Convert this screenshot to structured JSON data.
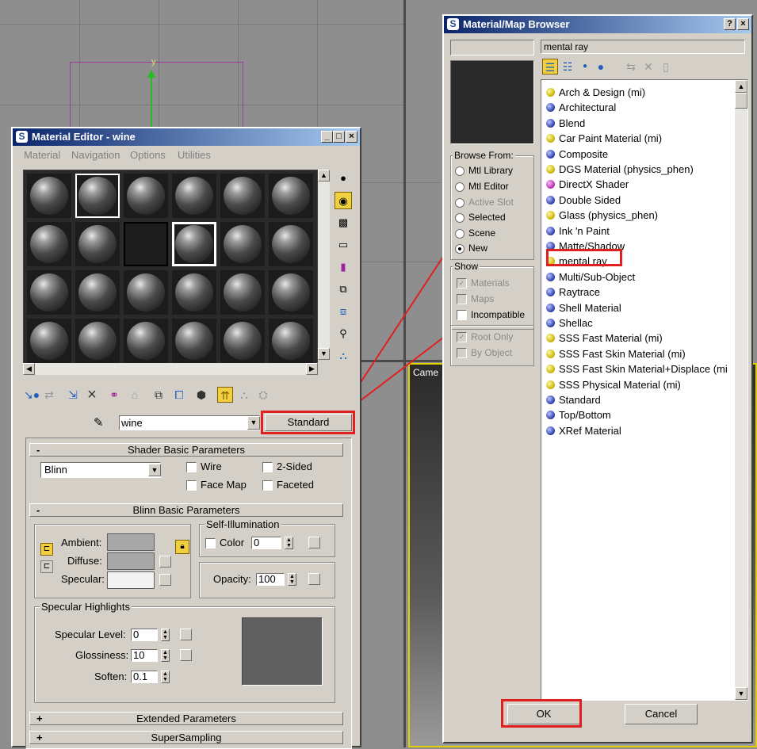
{
  "viewport": {
    "axis_label": "y",
    "camera_label": "Came"
  },
  "material_editor": {
    "title": "Material Editor - wine",
    "menu": [
      "Material",
      "Navigation",
      "Options",
      "Utilities"
    ],
    "title_buttons": [
      "_",
      "□",
      "×"
    ],
    "material_name": "wine",
    "material_type_button": "Standard",
    "shader_rollout": "Shader Basic Parameters",
    "shader_value": "Blinn",
    "shader_checks": {
      "wire": "Wire",
      "two_sided": "2-Sided",
      "face_map": "Face Map",
      "faceted": "Faceted"
    },
    "blinn_rollout": "Blinn Basic Parameters",
    "ambient_label": "Ambient:",
    "diffuse_label": "Diffuse:",
    "specular_label": "Specular:",
    "self_illum_label": "Self-Illumination",
    "color_label": "Color",
    "color_value": "0",
    "opacity_label": "Opacity:",
    "opacity_value": "100",
    "spec_highlights_label": "Specular Highlights",
    "spec_level_label": "Specular Level:",
    "spec_level_value": "0",
    "glossiness_label": "Glossiness:",
    "glossiness_value": "10",
    "soften_label": "Soften:",
    "soften_value": "0.1",
    "lock_icon": "lock-icon",
    "extended_rollout": "Extended Parameters",
    "supersampling_rollout": "SuperSampling",
    "plus": "+",
    "minus": "-"
  },
  "browser": {
    "title": "Material/Map Browser",
    "help_btn": "?",
    "close_btn": "×",
    "search_value": "mental ray",
    "browse_from_label": "Browse From:",
    "browse_from": [
      {
        "label": "Mtl Library",
        "selected": false,
        "enabled": true
      },
      {
        "label": "Mtl Editor",
        "selected": false,
        "enabled": true
      },
      {
        "label": "Active Slot",
        "selected": false,
        "enabled": false
      },
      {
        "label": "Selected",
        "selected": false,
        "enabled": true
      },
      {
        "label": "Scene",
        "selected": false,
        "enabled": true
      },
      {
        "label": "New",
        "selected": true,
        "enabled": true
      }
    ],
    "show_label": "Show",
    "show": [
      {
        "label": "Materials",
        "checked": true,
        "enabled": false
      },
      {
        "label": "Maps",
        "checked": false,
        "enabled": false
      },
      {
        "label": "Incompatible",
        "checked": false,
        "enabled": true
      }
    ],
    "extra": [
      {
        "label": "Root Only",
        "checked": true,
        "enabled": false
      },
      {
        "label": "By Object",
        "checked": false,
        "enabled": false
      }
    ],
    "items": [
      {
        "label": "Arch & Design (mi)",
        "color": "y"
      },
      {
        "label": "Architectural",
        "color": "b"
      },
      {
        "label": "Blend",
        "color": "b"
      },
      {
        "label": "Car Paint Material (mi)",
        "color": "y"
      },
      {
        "label": "Composite",
        "color": "b"
      },
      {
        "label": "DGS Material (physics_phen)",
        "color": "y"
      },
      {
        "label": "DirectX Shader",
        "color": "m"
      },
      {
        "label": "Double Sided",
        "color": "b"
      },
      {
        "label": "Glass (physics_phen)",
        "color": "y"
      },
      {
        "label": "Ink 'n Paint",
        "color": "b"
      },
      {
        "label": "Matte/Shadow",
        "color": "b"
      },
      {
        "label": "mental ray",
        "color": "y"
      },
      {
        "label": "Multi/Sub-Object",
        "color": "b"
      },
      {
        "label": "Raytrace",
        "color": "b"
      },
      {
        "label": "Shell Material",
        "color": "b"
      },
      {
        "label": "Shellac",
        "color": "b"
      },
      {
        "label": "SSS Fast Material (mi)",
        "color": "y"
      },
      {
        "label": "SSS Fast Skin Material (mi)",
        "color": "y"
      },
      {
        "label": "SSS Fast Skin Material+Displace (mi",
        "color": "y"
      },
      {
        "label": "SSS Physical Material (mi)",
        "color": "y"
      },
      {
        "label": "Standard",
        "color": "b"
      },
      {
        "label": "Top/Bottom",
        "color": "b"
      },
      {
        "label": "XRef Material",
        "color": "b"
      }
    ],
    "ok_label": "OK",
    "cancel_label": "Cancel"
  },
  "colors": {
    "title_bar": "#0a246a",
    "highlight_red": "#e02020",
    "panel": "#d4d0c8"
  }
}
